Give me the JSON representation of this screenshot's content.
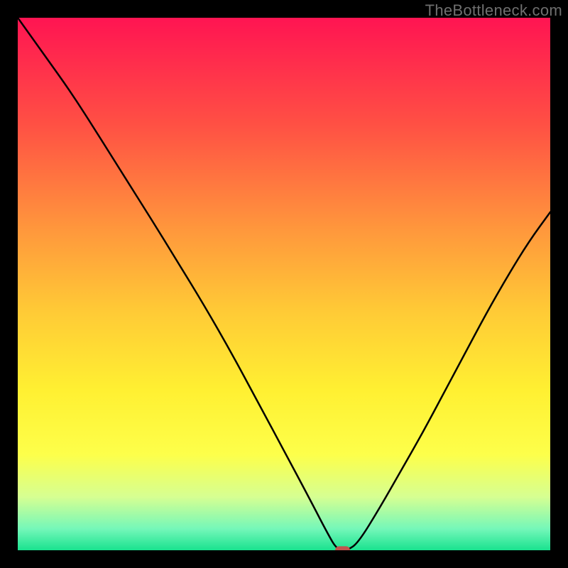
{
  "watermark": "TheBottleneck.com",
  "chart_data": {
    "type": "line",
    "title": "",
    "xlabel": "",
    "ylabel": "",
    "xlim": [
      0,
      100
    ],
    "ylim": [
      0,
      100
    ],
    "grid": false,
    "axes_visible": false,
    "background_gradient": {
      "stops": [
        {
          "offset": 0.0,
          "color": "#ff1452"
        },
        {
          "offset": 0.2,
          "color": "#ff5044"
        },
        {
          "offset": 0.4,
          "color": "#ff983c"
        },
        {
          "offset": 0.55,
          "color": "#ffca36"
        },
        {
          "offset": 0.7,
          "color": "#fff032"
        },
        {
          "offset": 0.82,
          "color": "#fdff4a"
        },
        {
          "offset": 0.9,
          "color": "#d6ff92"
        },
        {
          "offset": 0.96,
          "color": "#74f7b9"
        },
        {
          "offset": 1.0,
          "color": "#19e28f"
        }
      ]
    },
    "series": [
      {
        "name": "bottleneck-curve",
        "x": [
          0,
          5,
          10,
          15,
          20,
          25,
          30,
          35,
          40,
          45,
          50,
          55,
          58,
          60,
          62,
          64,
          68,
          72,
          76,
          80,
          84,
          88,
          92,
          96,
          100
        ],
        "y": [
          100,
          93.0,
          86.0,
          78.2,
          70.2,
          62.3,
          54.2,
          46.0,
          37.3,
          28.0,
          18.7,
          9.3,
          3.5,
          0.0,
          0.0,
          1.5,
          8.0,
          15.0,
          22.0,
          29.5,
          37.0,
          44.5,
          51.5,
          58.0,
          63.5
        ]
      }
    ],
    "marker": {
      "name": "bottleneck-point",
      "x": 61,
      "y": 0,
      "color": "#c1544e",
      "shape": "rounded-rect",
      "width_frac": 0.028,
      "height_frac": 0.015
    }
  }
}
